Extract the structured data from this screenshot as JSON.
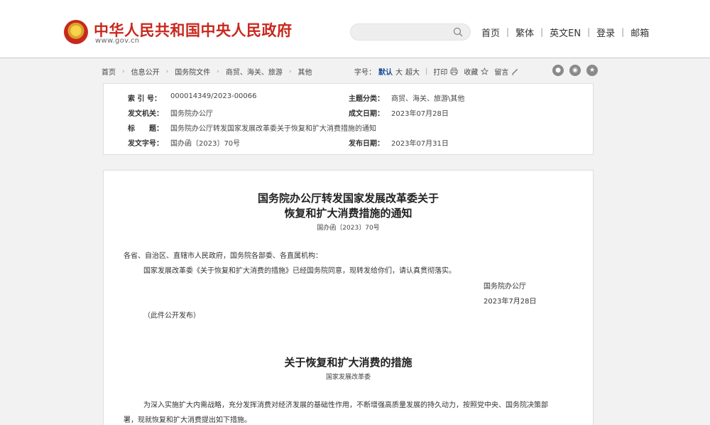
{
  "header": {
    "site_title": "中华人民共和国中央人民政府",
    "site_url": "www.gov.cn",
    "search_placeholder": "",
    "nav": [
      "首页",
      "繁体",
      "英文EN",
      "登录",
      "邮箱"
    ],
    "nav_separator": "|"
  },
  "breadcrumb": [
    "首页",
    "信息公开",
    "国务院文件",
    "商贸、海关、旅游",
    "其他"
  ],
  "breadcrumb_arrow": "›",
  "tools": {
    "font_label": "字号：",
    "sizes": [
      "默认",
      "大",
      "超大"
    ],
    "active_size": "默认",
    "divider": "|",
    "print": "打印",
    "favorite": "收藏",
    "comment": "留言"
  },
  "share_icons": [
    "weibo-icon",
    "wechat-icon",
    "qzone-icon"
  ],
  "meta": {
    "index_no_label": "索 引 号：",
    "index_no": "000014349/2023-00066",
    "category_label": "主题分类：",
    "category": "商贸、海关、旅游\\其他",
    "issuer_label": "发文机关：",
    "issuer": "国务院办公厅",
    "written_date_label": "成文日期：",
    "written_date": "2023年07月28日",
    "title_label": "标　　题：",
    "title": "国务院办公厅转发国家发展改革委关于恢复和扩大消费措施的通知",
    "doc_no_label": "发文字号：",
    "doc_no": "国办函〔2023〕70号",
    "publish_date_label": "发布日期：",
    "publish_date": "2023年07月31日"
  },
  "document": {
    "title_line1": "国务院办公厅转发国家发展改革委关于",
    "title_line2": "恢复和扩大消费措施的通知",
    "doc_no": "国办函〔2023〕70号",
    "salutation": "各省、自治区、直辖市人民政府，国务院各部委、各直属机构：",
    "body": "国家发展改革委《关于恢复和扩大消费的措施》已经国务院同意，现转发给你们，请认真贯彻落实。",
    "signer": "国务院办公厅",
    "sign_date": "2023年7月28日",
    "note": "（此件公开发布）",
    "section_title": "关于恢复和扩大消费的措施",
    "section_author": "国家发展改革委",
    "para_line1": "为深入实施扩大内需战略，充分发挥消费对经济发展的基础性作用，不断增强高质量发展的持久动力，按照党中央、国务院决策部",
    "para_line2": "署，现就恢复和扩大消费提出如下措施。"
  }
}
